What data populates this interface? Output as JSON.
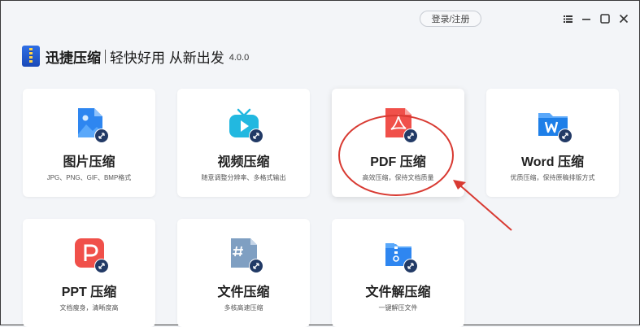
{
  "header": {
    "login_label": "登录/注册",
    "brand_name": "迅捷压缩",
    "slogan": "轻快好用 从新出发",
    "version": "4.0.0"
  },
  "window_controls": {
    "menu_icon": "menu-icon",
    "minimize_icon": "minimize-icon",
    "maximize_icon": "maximize-icon",
    "close_icon": "close-icon"
  },
  "cards": [
    {
      "title": "图片压缩",
      "desc": "JPG、PNG、GIF、BMP格式",
      "icon": "image-file-icon",
      "color": "#2e86f0"
    },
    {
      "title": "视频压缩",
      "desc": "随意调整分辨率、多格式输出",
      "icon": "tv-icon",
      "color": "#22b8e0"
    },
    {
      "title": "PDF 压缩",
      "desc": "高效压缩，保持文档质量",
      "icon": "pdf-file-icon",
      "color": "#f0504a"
    },
    {
      "title": "Word 压缩",
      "desc": "优质压缩，保持原稿排版方式",
      "icon": "word-folder-icon",
      "color": "#1e7fe8"
    },
    {
      "title": "PPT 压缩",
      "desc": "文档瘦身，清晰度高",
      "icon": "ppt-file-icon",
      "color": "#f0504a"
    },
    {
      "title": "文件压缩",
      "desc": "多核高速压缩",
      "icon": "hash-file-icon",
      "color": "#6b8fb5"
    },
    {
      "title": "文件解压缩",
      "desc": "一键解压文件",
      "icon": "unzip-file-icon",
      "color": "#2e86f0"
    }
  ],
  "colors": {
    "annotation_red": "#d83a32",
    "badge_navy": "#223a66"
  }
}
